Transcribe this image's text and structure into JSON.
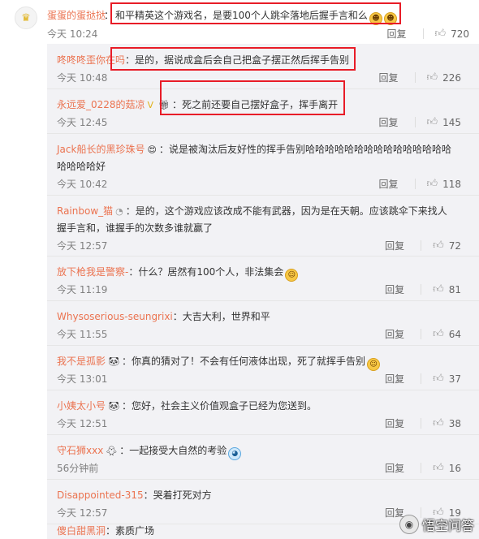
{
  "top_comment": {
    "user": "蛋蛋的蛋挞挞",
    "text": "和平精英这个游戏名，是要100个人跳伞落地后握手言和么",
    "time": "今天 10:24",
    "reply": "回复",
    "likes": "720"
  },
  "replies": [
    {
      "user": "咚咚咚歪你在吗",
      "text": "是的，据说成盒后会自己把盒子摆正然后挥手告别",
      "time": "今天 10:48",
      "reply": "回复",
      "likes": "226"
    },
    {
      "user": "永远爱_0228的菇凉",
      "text": "死之前还要自己摆好盒子，挥手离开",
      "time": "今天 12:45",
      "reply": "回复",
      "likes": "145"
    },
    {
      "user": "Jack船长的黑珍珠号",
      "text": "说是被淘汰后友好性的挥手告别哈哈哈哈哈哈哈哈哈哈哈哈哈哈哈哈哈哈哈好",
      "time": "今天 10:42",
      "reply": "回复",
      "likes": "118"
    },
    {
      "user": "Rainbow_猫",
      "text": "是的，这个游戏应该改成不能有武器，因为是在天朝。应该跳伞下来找人握手言和，谁握手的次数多谁就赢了",
      "time": "今天 12:57",
      "reply": "回复",
      "likes": "72"
    },
    {
      "user": "放下枪我是警察-",
      "text": "什么？居然有100个人，非法集会",
      "time": "今天 11:19",
      "reply": "回复",
      "likes": "81"
    },
    {
      "user": "Whysoserious-seungrixi",
      "text": "大吉大利，世界和平",
      "time": "今天 11:55",
      "reply": "回复",
      "likes": "64"
    },
    {
      "user": "我不是孤影",
      "text": "你真的猜对了！不会有任何液体出现，死了就挥手告别",
      "time": "今天 13:01",
      "reply": "回复",
      "likes": "37"
    },
    {
      "user": "小姨太小号",
      "text": "您好，社会主义价值观盒子已经为您送到。",
      "time": "今天 12:51",
      "reply": "回复",
      "likes": "38"
    },
    {
      "user": "守石狮xxx",
      "text": "一起接受大自然的考验",
      "time": "56分钟前",
      "reply": "回复",
      "likes": "16"
    },
    {
      "user": "Disappointed-315",
      "text": "哭着打死对方",
      "time": "今天 12:57",
      "reply": "回复",
      "likes": "19"
    },
    {
      "user": "傻白甜黑洞",
      "text": "素质广场",
      "time": "",
      "reply": "",
      "likes": ""
    }
  ],
  "watermark": "悟空问答",
  "colors": {
    "username": "#eb7350",
    "highlight": "#e81c27",
    "list_bg": "#f2f2f5"
  },
  "icons": {
    "like": "thumbs-up-icon",
    "avatar": "crown-icon"
  }
}
